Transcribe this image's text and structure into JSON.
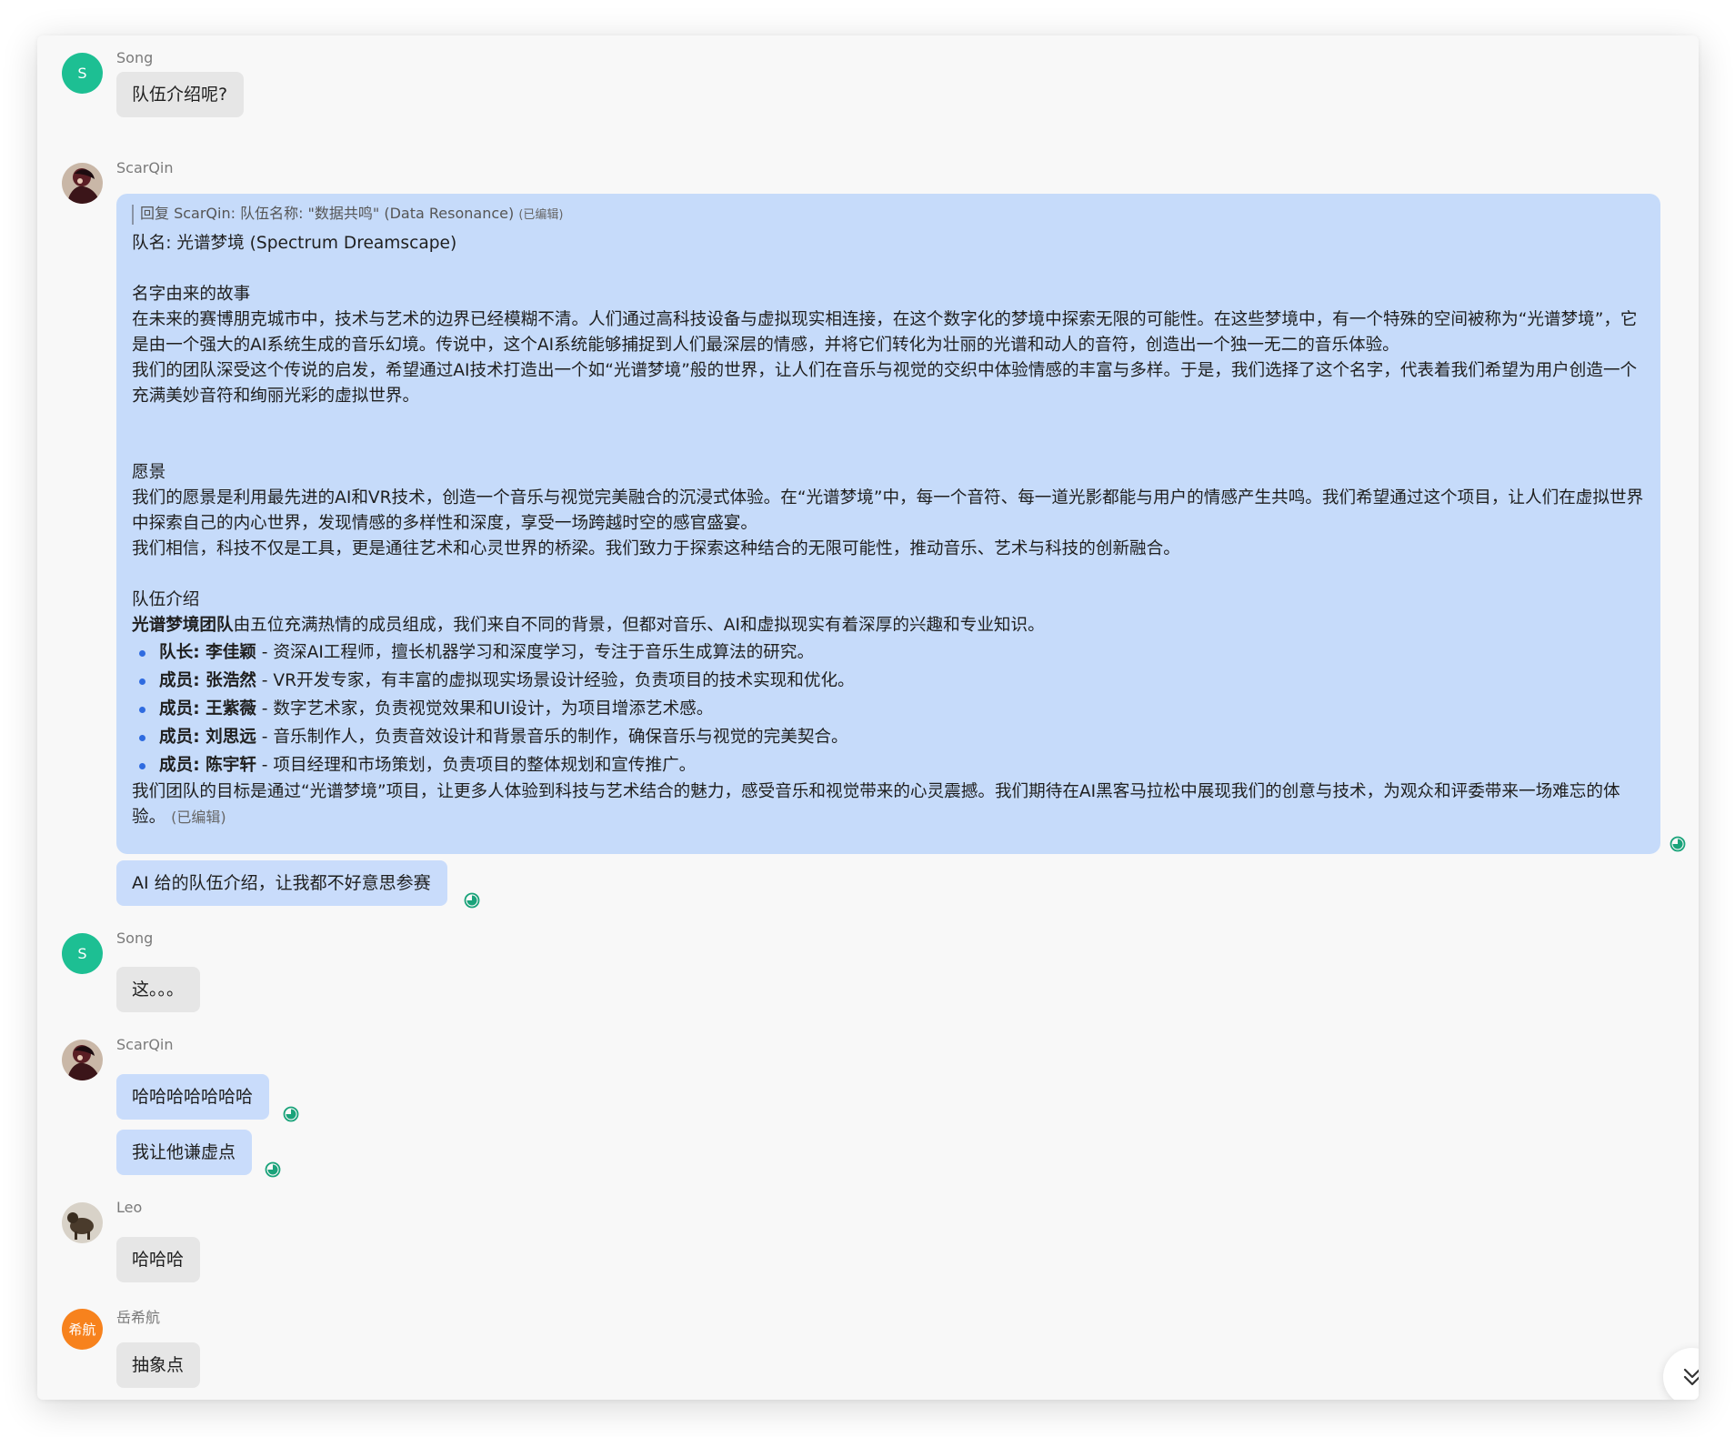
{
  "messages": [
    {
      "sender": "Song",
      "avatar_text": "S",
      "text": "队伍介绍呢?"
    },
    {
      "sender": "ScarQin",
      "reply_quote": "回复 ScarQin: 队伍名称: \"数据共鸣\" (Data Resonance)",
      "reply_quote_edited": "(已编辑)",
      "team_name_line": "队名: 光谱梦境 (Spectrum Dreamscape)",
      "story_title": "名字由来的故事",
      "story_p1": "在未来的赛博朋克城市中，技术与艺术的边界已经模糊不清。人们通过高科技设备与虚拟现实相连接，在这个数字化的梦境中探索无限的可能性。在这些梦境中，有一个特殊的空间被称为“光谱梦境”，它是由一个强大的AI系统生成的音乐幻境。传说中，这个AI系统能够捕捉到人们最深层的情感，并将它们转化为壮丽的光谱和动人的音符，创造出一个独一无二的音乐体验。",
      "story_p2": "我们的团队深受这个传说的启发，希望通过AI技术打造出一个如“光谱梦境”般的世界，让人们在音乐与视觉的交织中体验情感的丰富与多样。于是，我们选择了这个名字，代表着我们希望为用户创造一个充满美妙音符和绚丽光彩的虚拟世界。",
      "vision_title": "愿景",
      "vision_p1": "我们的愿景是利用最先进的AI和VR技术，创造一个音乐与视觉完美融合的沉浸式体验。在“光谱梦境”中，每一个音符、每一道光影都能与用户的情感产生共鸣。我们希望通过这个项目，让人们在虚拟世界中探索自己的内心世界，发现情感的多样性和深度，享受一场跨越时空的感官盛宴。",
      "vision_p2": "我们相信，科技不仅是工具，更是通往艺术和心灵世界的桥梁。我们致力于探索这种结合的无限可能性，推动音乐、艺术与科技的创新融合。",
      "team_title": "队伍介绍",
      "team_intro_bold": "光谱梦境团队",
      "team_intro_rest": "由五位充满热情的成员组成，我们来自不同的背景，但都对音乐、AI和虚拟现实有着深厚的兴趣和专业知识。",
      "members": [
        {
          "role": "队长: 李佳颖",
          "desc": " - 资深AI工程师，擅长机器学习和深度学习，专注于音乐生成算法的研究。"
        },
        {
          "role": "成员: 张浩然",
          "desc": " - VR开发专家，有丰富的虚拟现实场景设计经验，负责项目的技术实现和优化。"
        },
        {
          "role": "成员: 王紫薇",
          "desc": " - 数字艺术家，负责视觉效果和UI设计，为项目增添艺术感。"
        },
        {
          "role": "成员: 刘思远",
          "desc": " - 音乐制作人，负责音效设计和背景音乐的制作，确保音乐与视觉的完美契合。"
        },
        {
          "role": "成员: 陈宇轩",
          "desc": " - 项目经理和市场策划，负责项目的整体规划和宣传推广。"
        }
      ],
      "closing": "我们团队的目标是通过“光谱梦境”项目，让更多人体验到科技与艺术结合的魅力，感受音乐和视觉带来的心灵震撼。我们期待在AI黑客马拉松中展现我们的创意与技术，为观众和评委带来一场难忘的体验。",
      "closing_edited": "(已编辑)",
      "followup": "AI 给的队伍介绍，让我都不好意思参赛"
    },
    {
      "sender": "Song",
      "avatar_text": "S",
      "text": "这。。。"
    },
    {
      "sender": "ScarQin",
      "texts": [
        "哈哈哈哈哈哈哈",
        "我让他谦虚点"
      ]
    },
    {
      "sender": "Leo",
      "text": "哈哈哈"
    },
    {
      "sender": "岳希航",
      "avatar_text": "希航",
      "text": "抽象点"
    }
  ],
  "icons": {
    "read_receipt": "read-check-icon",
    "scroll_down": "double-chevron-down-icon"
  },
  "colors": {
    "my_bubble": "#c6dbfa",
    "other_bubble": "#e6e6e6",
    "song_avatar": "#1dbf93",
    "yue_avatar": "#f7821d",
    "read_icon": "#1aa37a"
  }
}
